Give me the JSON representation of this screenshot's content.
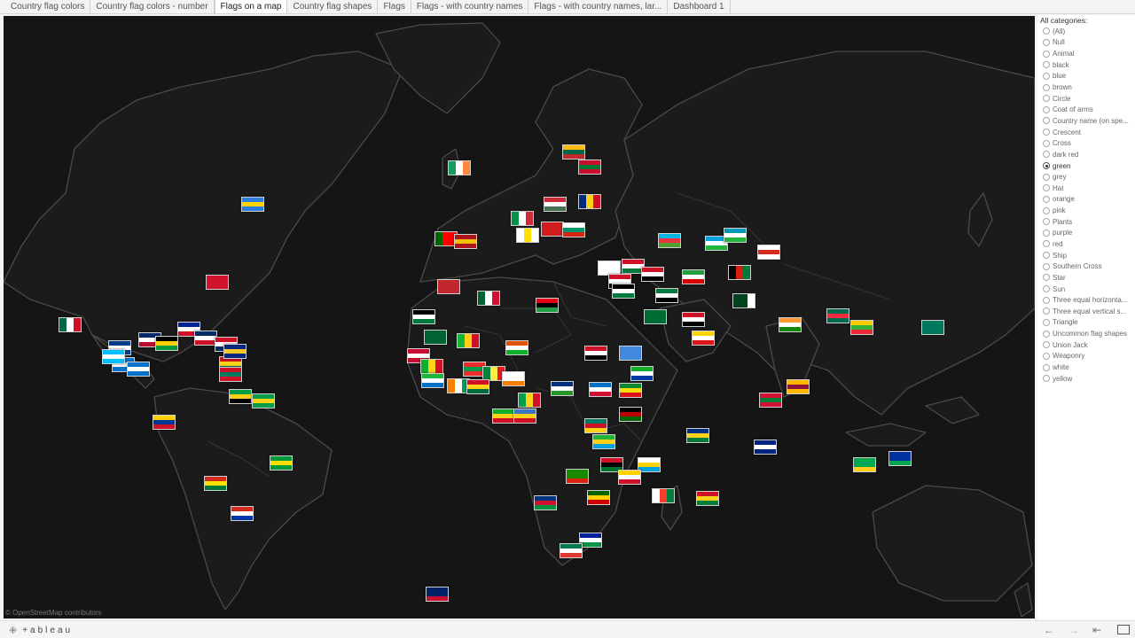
{
  "tabs": [
    {
      "label": "Country flag colors"
    },
    {
      "label": "Country flag colors - number"
    },
    {
      "label": "Flags on a map",
      "active": true
    },
    {
      "label": "Country flag shapes"
    },
    {
      "label": "Flags"
    },
    {
      "label": "Flags - with country names"
    },
    {
      "label": "Flags - with country names, lar..."
    },
    {
      "label": "Dashboard 1"
    }
  ],
  "map": {
    "attribution": "© OpenStreetMap contributors",
    "background_color": "#151515",
    "coastline_color": "#4a4a4a"
  },
  "filter": {
    "title": "All categories:",
    "selected": "green",
    "options": [
      "(All)",
      "Null",
      "Animal",
      "black",
      "blue",
      "brown",
      "Circle",
      "Coat of arms",
      "Country name (on spe...",
      "Crescent",
      "Cross",
      "dark red",
      "green",
      "grey",
      "Hat",
      "orange",
      "pink",
      "Plants",
      "purple",
      "red",
      "Ship",
      "Southern Cross",
      "Star",
      "Sun",
      "Three equal horizonta...",
      "Three equal vertical s...",
      "Triangle",
      "Uncommon flag shapes",
      "Union Jack",
      "Weaponry",
      "white",
      "yellow"
    ]
  },
  "footer": {
    "brand": "+ableau",
    "nav_icons": [
      "undo-icon",
      "redo-icon",
      "revert-icon",
      "fullscreen-icon"
    ]
  }
}
